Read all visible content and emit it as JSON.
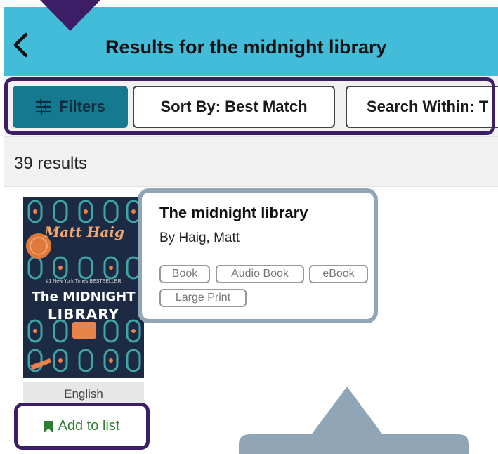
{
  "header": {
    "title": "Results for the midnight library",
    "background": "#42bcd9"
  },
  "annotations": {
    "color": "#3d1e66",
    "card_outline_color": "#90a6b7"
  },
  "toolbar": {
    "filters_label": "Filters",
    "sort_label": "Sort By: Best Match",
    "search_within_label": "Search Within: T"
  },
  "results": {
    "count_text": "39 results"
  },
  "book": {
    "title": "The midnight library",
    "author": "By Haig, Matt",
    "formats": [
      "Book",
      "Audio Book",
      "eBook",
      "Large Print"
    ],
    "language": "English",
    "add_to_list_label": "Add to list",
    "cover": {
      "author_text": "Matt Haig",
      "title_line1": "The MIDNIGHT",
      "title_line2": "LIBRARY",
      "tagline": "#1 New York Times BESTSELLER"
    }
  }
}
